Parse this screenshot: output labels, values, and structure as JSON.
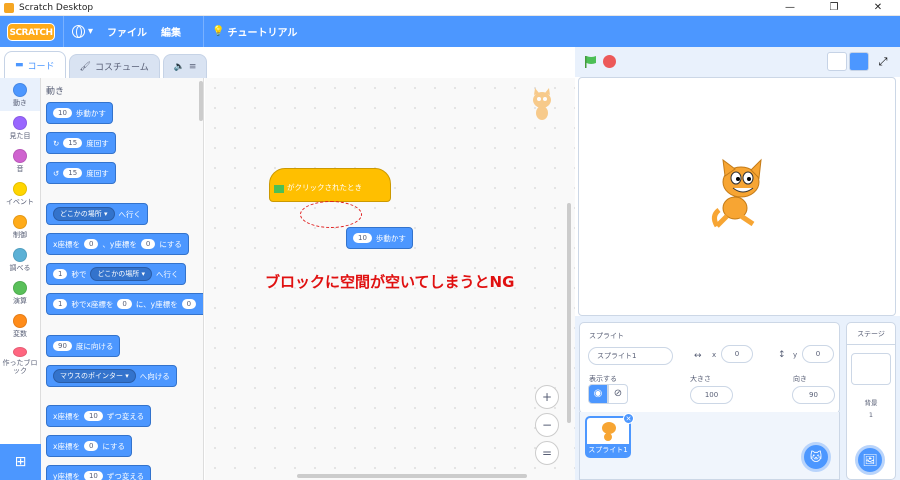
{
  "window": {
    "title": "Scratch Desktop",
    "controls": [
      "—",
      "❐",
      "✕"
    ]
  },
  "menubar": {
    "logo": "SCRATCH",
    "items": [
      "ファイル",
      "編集"
    ],
    "tutorial": "チュートリアル"
  },
  "tabs": [
    {
      "label": "コード",
      "active": true
    },
    {
      "label": "コスチューム",
      "active": false
    },
    {
      "label": "",
      "active": false
    }
  ],
  "categories": [
    {
      "label": "動き",
      "color": "#4c97ff"
    },
    {
      "label": "見た目",
      "color": "#9966ff"
    },
    {
      "label": "音",
      "color": "#cf63cf"
    },
    {
      "label": "イベント",
      "color": "#ffd500"
    },
    {
      "label": "制御",
      "color": "#ffab19"
    },
    {
      "label": "調べる",
      "color": "#5cb1d6"
    },
    {
      "label": "演算",
      "color": "#59c059"
    },
    {
      "label": "変数",
      "color": "#ff8c1a"
    },
    {
      "label": "作ったブロック",
      "color": "#ff6680"
    }
  ],
  "palette": {
    "title": "動き",
    "blocks": {
      "move": {
        "value": "10",
        "text": "歩動かす"
      },
      "turn_right": {
        "value": "15",
        "text": "度回す"
      },
      "turn_left": {
        "value": "15",
        "text": "度回す"
      },
      "goto": {
        "dropdown": "どこかの場所",
        "text": "へ行く"
      },
      "goto_xy": {
        "x_label": "x座標を",
        "x": "0",
        "y_label": "、y座標を",
        "y": "0",
        "text": "にする"
      },
      "glide": {
        "value": "1",
        "mid": "秒で",
        "dropdown": "どこかの場所",
        "text": "へ行く"
      },
      "glide_xy": {
        "value": "1",
        "mid": "秒でx座標を",
        "x": "0",
        "y_label": "に、y座標を",
        "y": "0"
      },
      "point_dir": {
        "value": "90",
        "text": "度に向ける"
      },
      "point_towards": {
        "dropdown": "マウスのポインター",
        "text": "へ向ける"
      },
      "change_x": {
        "label": "x座標を",
        "value": "10",
        "text": "ずつ変える"
      },
      "set_x": {
        "label": "x座標を",
        "value": "0",
        "text": "にする"
      },
      "change_y": {
        "label": "y座標を",
        "value": "10",
        "text": "ずつ変える"
      }
    }
  },
  "workspace": {
    "hat_block": "がクリックされたとき",
    "move_block": {
      "value": "10",
      "text": "歩動かす"
    },
    "annotation": "ブロックに空間が空いてしまうとNG",
    "zoom": [
      "+",
      "−",
      "="
    ]
  },
  "sprite_info": {
    "sprite_label": "スプライト",
    "sprite_name": "スプライト1",
    "x_label": "x",
    "x": "0",
    "y_label": "y",
    "y": "0",
    "show_label": "表示する",
    "size_label": "大きさ",
    "size": "100",
    "direction_label": "向き",
    "direction": "90"
  },
  "sprite_list": {
    "thumb_label": "スプライト1"
  },
  "stage_panel": {
    "title": "ステージ",
    "backdrop_label": "背景",
    "backdrop_count": "1"
  }
}
